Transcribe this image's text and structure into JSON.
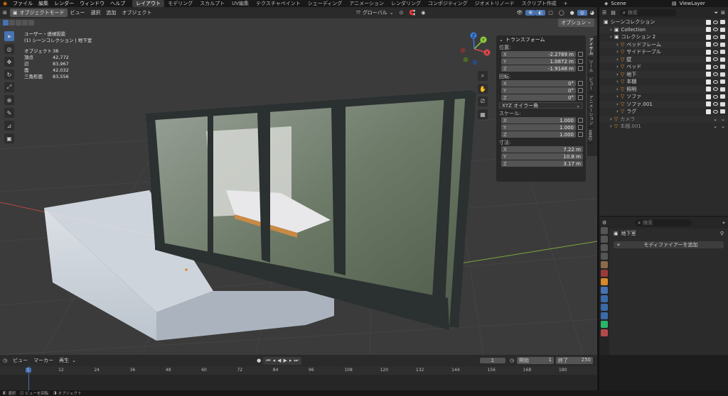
{
  "topbar": {
    "menus": [
      "ファイル",
      "編集",
      "レンダー",
      "ウィンドウ",
      "ヘルプ"
    ],
    "workspaces": [
      "レイアウト",
      "モデリング",
      "スカルプト",
      "UV編集",
      "テクスチャペイント",
      "シェーディング",
      "アニメーション",
      "レンダリング",
      "コンポジティング",
      "ジオメトリノード",
      "スクリプト作成"
    ],
    "add_tab": "+",
    "scene": "Scene",
    "view_layer": "ViewLayer"
  },
  "viewport_header": {
    "mode": "オブジェクトモード",
    "menus": [
      "ビュー",
      "選択",
      "追加",
      "オブジェクト"
    ],
    "transform_orientation": "グローバル",
    "options": "オプション"
  },
  "viewport_info": {
    "view_name": "ユーザー・透視投影",
    "collection_line": "(1) シーンコレクション | 地下室",
    "stats": [
      {
        "label": "オブジェクト",
        "value": "38"
      },
      {
        "label": "頂点",
        "value": "42,772"
      },
      {
        "label": "辺",
        "value": "83,967"
      },
      {
        "label": "面",
        "value": "42,032"
      },
      {
        "label": "三角形面",
        "value": "83,556"
      }
    ]
  },
  "gizmo": {
    "x": "X",
    "y": "Y",
    "z": "Z"
  },
  "npanel": {
    "title": "トランスフォーム",
    "location_label": "位置:",
    "location": [
      {
        "axis": "X",
        "value": "-2.2789 m"
      },
      {
        "axis": "Y",
        "value": "1.0872 m"
      },
      {
        "axis": "Z",
        "value": "-1.9148 m"
      }
    ],
    "rotation_label": "回転:",
    "rotation": [
      {
        "axis": "X",
        "value": "0°"
      },
      {
        "axis": "Y",
        "value": "0°"
      },
      {
        "axis": "Z",
        "value": "0°"
      }
    ],
    "rotation_mode": "XYZ オイラー角",
    "scale_label": "スケール:",
    "scale": [
      {
        "axis": "X",
        "value": "1.000"
      },
      {
        "axis": "Y",
        "value": "1.000"
      },
      {
        "axis": "Z",
        "value": "1.000"
      }
    ],
    "dimensions_label": "寸法:",
    "dimensions": [
      {
        "axis": "X",
        "value": "7.22 m"
      },
      {
        "axis": "Y",
        "value": "10.8 m"
      },
      {
        "axis": "Z",
        "value": "3.17 m"
      }
    ]
  },
  "side_tabs": [
    "アイテム",
    "ツール",
    "ビュー",
    "アニメーション",
    "MMD"
  ],
  "outliner": {
    "search_placeholder": "検索",
    "items": [
      {
        "name": "シーンコレクション",
        "level": 0
      },
      {
        "name": "Collection",
        "level": 1
      },
      {
        "name": "コレクション 2",
        "level": 1
      },
      {
        "name": "ベッドフレーム",
        "level": 2
      },
      {
        "name": "サイドテーブル",
        "level": 2
      },
      {
        "name": "壁",
        "level": 2
      },
      {
        "name": "ベッド",
        "level": 2
      },
      {
        "name": "地下",
        "level": 2
      },
      {
        "name": "本棚",
        "level": 2
      },
      {
        "name": "照明",
        "level": 2
      },
      {
        "name": "ソファ",
        "level": 2
      },
      {
        "name": "ソファ.001",
        "level": 2
      },
      {
        "name": "ラグ",
        "level": 2
      },
      {
        "name": "カメラ",
        "level": 1
      },
      {
        "name": "本棚.001",
        "level": 1
      }
    ]
  },
  "properties": {
    "search_placeholder": "検索",
    "object_name": "地下室",
    "add_modifier": "モディファイアーを追加"
  },
  "timeline": {
    "menus": [
      "ビュー",
      "マーカー",
      "再生"
    ],
    "current_frame": "1",
    "start_label": "開始",
    "start": "1",
    "end_label": "終了",
    "end": "250",
    "ticks": [
      "1",
      "12",
      "24",
      "36",
      "48",
      "60",
      "72",
      "84",
      "96",
      "108",
      "120",
      "132",
      "144",
      "156",
      "168",
      "180"
    ]
  },
  "statusbar": {
    "items": [
      "選択",
      "ビューを回転",
      "オブジェクト"
    ]
  },
  "colors": {
    "accent": "#4772b3",
    "x_axis": "#e04a4a",
    "y_axis": "#8ccf3a",
    "z_axis": "#3a7de0"
  }
}
